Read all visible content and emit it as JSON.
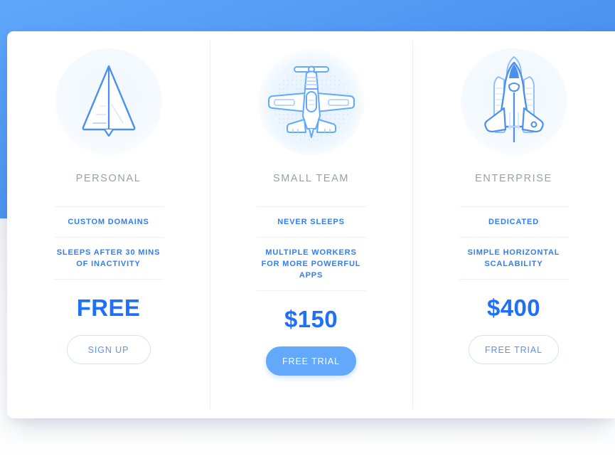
{
  "theme": {
    "band_blue": "#4a90f0",
    "accent_blue": "#1f6ffa",
    "feature_blue": "#2f7ef5",
    "button_fill": "#62a9fb",
    "plan_name_gray": "#9b9fa6",
    "divider": "#eaf2fb"
  },
  "card": {
    "plans": [
      {
        "icon": "paper-plane-icon",
        "name": "PERSONAL",
        "features": [
          "CUSTOM DOMAINS",
          "SLEEPS AFTER 30 MINS OF INACTIVITY"
        ],
        "price": "FREE",
        "cta_label": "SIGN UP",
        "cta_style": "outline",
        "highlighted": false
      },
      {
        "icon": "propeller-plane-icon",
        "name": "SMALL TEAM",
        "features": [
          "NEVER SLEEPS",
          "MULTIPLE WORKERS FOR MORE POWERFUL APPS"
        ],
        "price": "$150",
        "cta_label": "FREE TRIAL",
        "cta_style": "filled",
        "highlighted": true
      },
      {
        "icon": "space-shuttle-icon",
        "name": "ENTERPRISE",
        "features": [
          "DEDICATED",
          "SIMPLE HORIZONTAL SCALABILITY"
        ],
        "price": "$400",
        "cta_label": "FREE TRIAL",
        "cta_style": "outline",
        "highlighted": false
      }
    ]
  }
}
